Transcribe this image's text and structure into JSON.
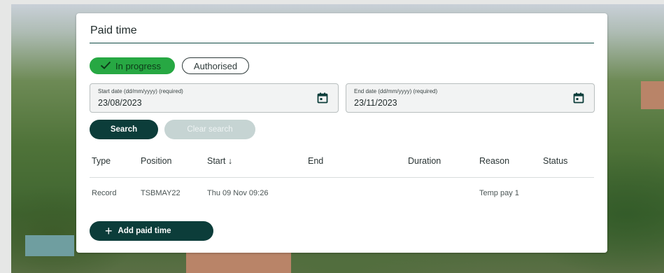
{
  "page": {
    "title": "Paid time"
  },
  "filters": {
    "in_progress": "In progress",
    "authorised": "Authorised"
  },
  "start_date": {
    "label": "Start date (dd/mm/yyyy) (required)",
    "value": "23/08/2023"
  },
  "end_date": {
    "label": "End date (dd/mm/yyyy) (required)",
    "value": "23/11/2023"
  },
  "actions": {
    "search": "Search",
    "clear_search": "Clear search",
    "add_paid_time": "Add paid time"
  },
  "table": {
    "columns": [
      "Type",
      "Position",
      "Start",
      "End",
      "Duration",
      "Reason",
      "Status"
    ],
    "sort_indicator": "↓",
    "rows": [
      {
        "type": "Record",
        "position": "TSBMAY22",
        "start": "Thu 09 Nov 09:26",
        "end": "",
        "duration": "",
        "reason": "Temp pay 1",
        "status": ""
      }
    ]
  },
  "colors": {
    "accent": "#0c3d3a",
    "active_chip": "#27a843"
  }
}
